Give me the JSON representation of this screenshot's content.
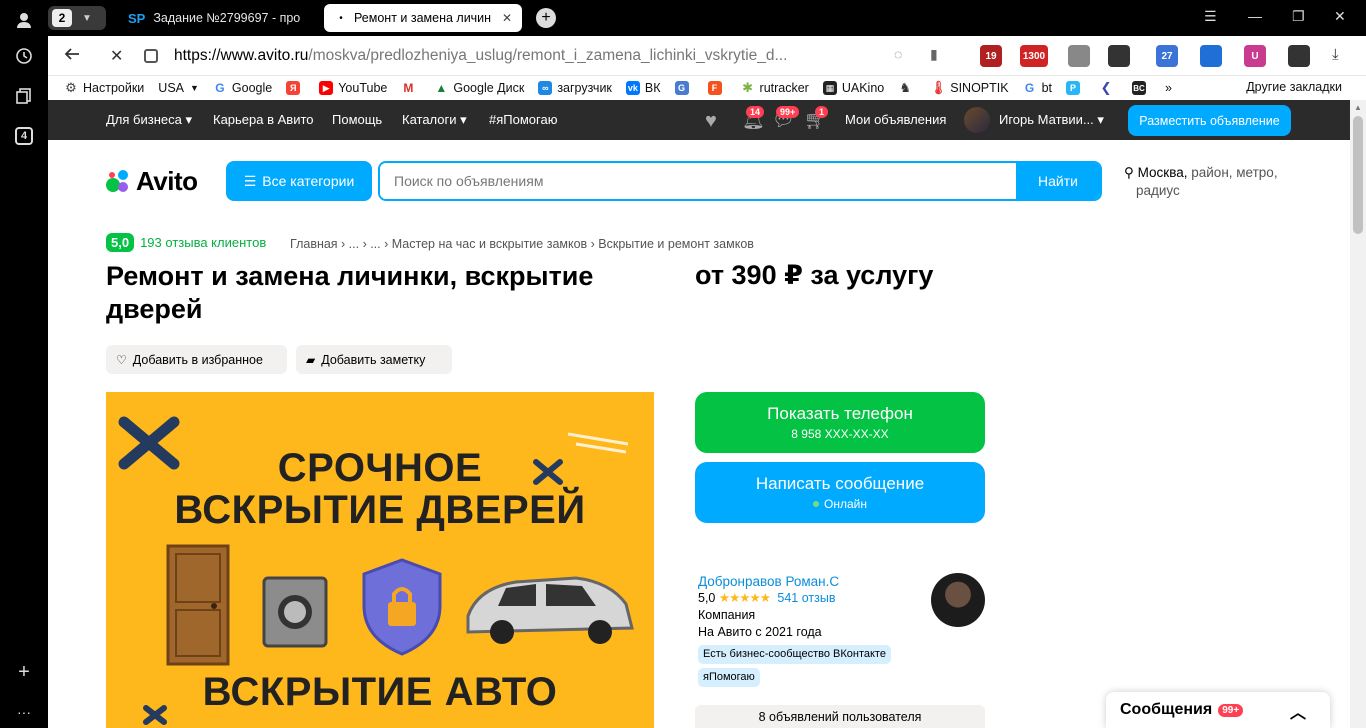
{
  "browser": {
    "tab_count": "2",
    "tabs": [
      {
        "label": "Задание №2799697 - про",
        "favicon": "SP"
      },
      {
        "label": "Ремонт и замена личин"
      }
    ],
    "url_host": "https://www.avito.ru",
    "url_path": "/moskva/predlozheniya_uslug/remont_i_zamena_lichinki_vskrytie_d...",
    "extensions": [
      {
        "label": "19",
        "color": "#b02020"
      },
      {
        "label": "1300",
        "color": "#d02424"
      },
      {
        "label": "",
        "color": "#888888"
      },
      {
        "label": "",
        "color": "#333333"
      },
      {
        "label": "27",
        "color": "#3b74d6"
      },
      {
        "label": "",
        "color": "#1f6fd6"
      },
      {
        "label": "U",
        "color": "#c83b8e"
      },
      {
        "label": "",
        "color": "#333333"
      }
    ],
    "left_badge": "4",
    "bookmarks": [
      {
        "label": "Настройки",
        "color": "#444444"
      },
      {
        "label": "USA",
        "color": "#ffffff"
      },
      {
        "label": "Google",
        "color": "#4285f4"
      },
      {
        "label": "",
        "color": "#f44336"
      },
      {
        "label": "YouTube",
        "color": "#ff0000"
      },
      {
        "label": "",
        "color": "#d93025"
      },
      {
        "label": "Google Диск",
        "color": "#188038"
      },
      {
        "label": "загрузчик",
        "color": "#1e88e5"
      },
      {
        "label": "ВК",
        "color": "#0077ff"
      },
      {
        "label": "",
        "color": "#4a7bd0"
      },
      {
        "label": "",
        "color": "#f4511e"
      },
      {
        "label": "rutracker",
        "color": "#7cb342"
      },
      {
        "label": "UAKino",
        "color": "#222222"
      },
      {
        "label": "",
        "color": "#333333"
      },
      {
        "label": "SINOPTIK",
        "color": "#e53935"
      },
      {
        "label": "bt",
        "color": "#4285f4"
      },
      {
        "label": "",
        "color": "#29b6f6"
      },
      {
        "label": "",
        "color": "#3949ab"
      },
      {
        "label": "",
        "color": "#222222"
      }
    ],
    "bookmarks_more": "»",
    "other_bookmarks": "Другие закладки"
  },
  "topbar": {
    "items": [
      "Для бизнеса",
      "Карьера в Авито",
      "Помощь",
      "Каталоги",
      "#яПомогаю"
    ],
    "badges": {
      "notifications": "14",
      "messages": "99+",
      "cart": "1"
    },
    "my_ads": "Мои объявления",
    "user": "Игорь Матвии...",
    "post_button": "Разместить объявление"
  },
  "header": {
    "logo": "Avito",
    "categories_button": "Все категории",
    "search_placeholder": "Поиск по объявлениям",
    "search_button": "Найти",
    "location_city": "Москва,",
    "location_rest": " район, метро,",
    "location_radius": "радиус"
  },
  "listing": {
    "rating": "5,0",
    "reviews": "193 отзыва клиентов",
    "breadcrumb": "Главная › ... › ... › Мастер на час и вскрытие замков › Вскрытие и ремонт замков",
    "title": "Ремонт и замена личинки, вскрытие дверей",
    "price": "от 390 ₽ за услугу",
    "add_favorite": "Добавить в избранное",
    "add_note": "Добавить заметку",
    "banner_line1": "СРОЧНОЕ",
    "banner_line2": "ВСКРЫТИЕ ДВЕРЕЙ",
    "banner_line3": "ВСКРЫТИЕ АВТО"
  },
  "contact": {
    "show_phone": "Показать телефон",
    "phone_masked": "8 958 XXX-XX-XX",
    "write_message": "Написать сообщение",
    "online": "Онлайн"
  },
  "seller": {
    "name": "Добронравов Роман.С",
    "rating": "5,0",
    "stars": "★★★★★",
    "reviews": "541 отзыв",
    "type": "Компания",
    "since": "На Авито с 2021 года",
    "chip1": "Есть бизнес-сообщество ВКонтакте",
    "chip2": "яПомогаю",
    "ads_count": "8 объявлений пользователя"
  },
  "messenger": {
    "label": "Сообщения",
    "badge": "99+"
  }
}
